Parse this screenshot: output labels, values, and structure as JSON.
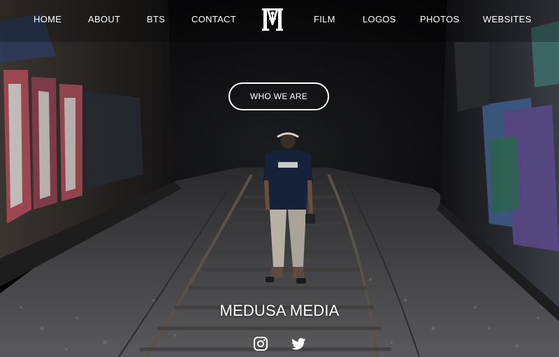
{
  "nav": {
    "left": [
      "HOME",
      "ABOUT",
      "BTS",
      "CONTACT"
    ],
    "right": [
      "FILM",
      "LOGOS",
      "PHOTOS",
      "WEBSITES"
    ],
    "logo_icon": "medusa-m-monogram-icon"
  },
  "hero": {
    "cta_label": "WHO WE ARE",
    "brand_title": "MEDUSA MEDIA"
  },
  "social": {
    "icons": [
      "instagram-icon",
      "twitter-icon"
    ]
  },
  "colors": {
    "text": "#ffffff",
    "background": "#0b0b0c"
  }
}
